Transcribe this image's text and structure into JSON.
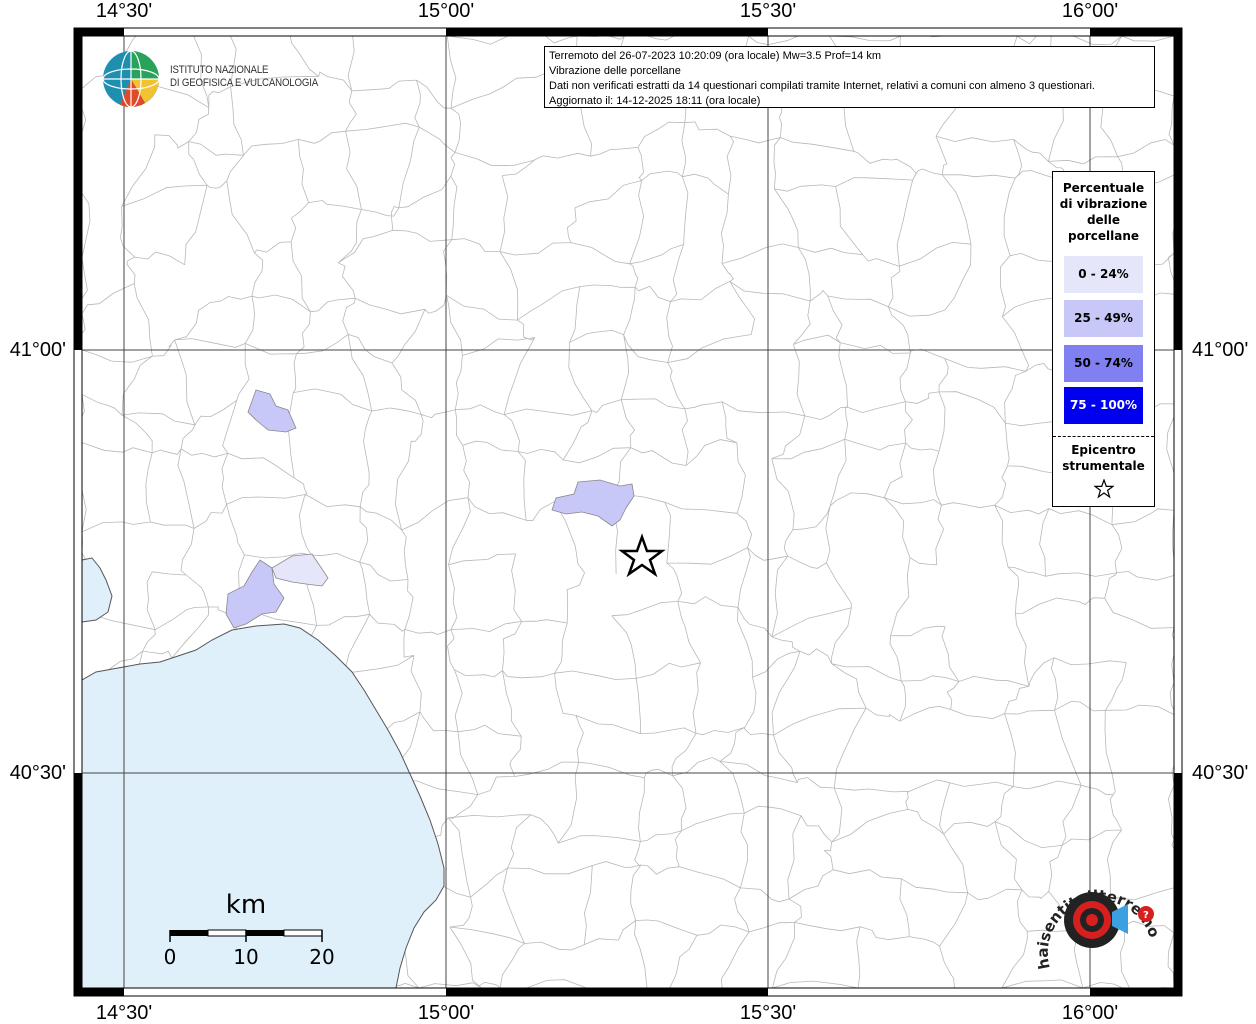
{
  "map_frame": {
    "lon_labels": [
      "14°30'",
      "15°00'",
      "15°30'",
      "16°00'"
    ],
    "lat_labels": [
      "41°00'",
      "40°30'"
    ]
  },
  "info": {
    "line1": "Terremoto del 26-07-2023 10:20:09 (ora locale) Mw=3.5 Prof=14 km",
    "line2": "Vibrazione delle porcellane",
    "line3": "Dati non verificati estratti da 14 questionari compilati tramite Internet, relativi a comuni con almeno 3 questionari.",
    "line4": "Aggiornato il: 14-12-2025 18:11 (ora locale)"
  },
  "logo": {
    "line1": "ISTITUTO NAZIONALE",
    "line2": "DI GEOFISICA E VULCANOLOGIA"
  },
  "legend": {
    "title": [
      "Percentuale",
      "di vibrazione",
      "delle",
      "porcellane"
    ],
    "items": [
      {
        "label": "0 - 24%",
        "color": "#e6e6fa",
        "text_color": "#000000"
      },
      {
        "label": "25 - 49%",
        "color": "#c8c8f8",
        "text_color": "#000000"
      },
      {
        "label": "50 - 74%",
        "color": "#8080f0",
        "text_color": "#000000"
      },
      {
        "label": "75 - 100%",
        "color": "#0000ee",
        "text_color": "#ffffff"
      }
    ],
    "epicenter_title": [
      "Epicentro",
      "strumentale"
    ],
    "epicenter_icon": "star-icon"
  },
  "scale_bar": {
    "unit": "km",
    "ticks": [
      "0",
      "10",
      "20"
    ]
  },
  "colors": {
    "sea": "#dff0fb",
    "border": "#b0b0b0",
    "grid": "#444444"
  },
  "watermark": {
    "text": "haisentitoilterremoto.it",
    "icon": "seismic-target-icon"
  }
}
